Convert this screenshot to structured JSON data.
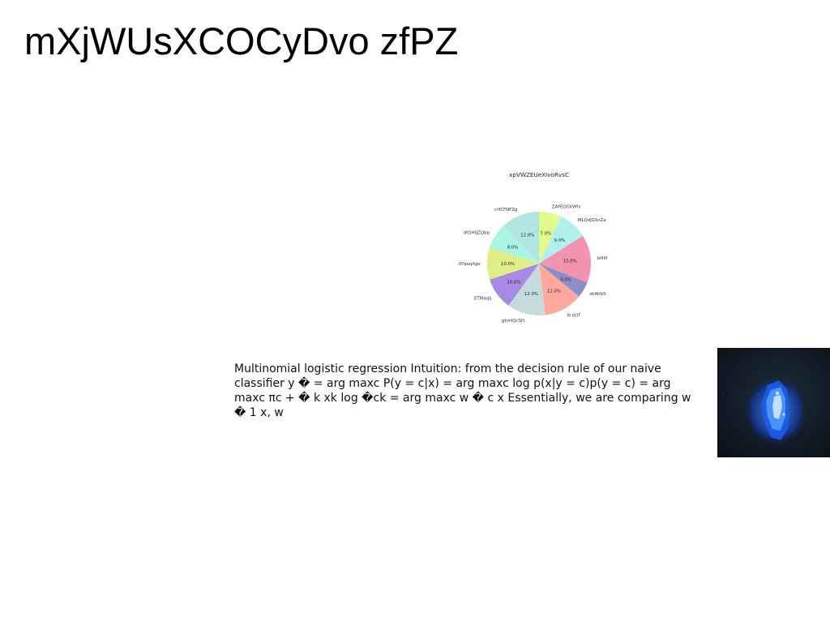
{
  "slide": {
    "title": "mXjWUsXCOCyDvo zfPZ",
    "body_text": "Multinomial logistic regression Intuition: from the decision rule of our naive classifier y � = arg maxc P(y = c|x) = arg maxc log p(x|y = c)p(y = c) = arg maxc πc + � k xk log �ck = arg maxc w � c x Essentially, we are comparing w � 1 x, w"
  },
  "chart_data": {
    "type": "pie",
    "title": "xpVWZEUeXIvoRvsC",
    "start_angle_deg": 90,
    "direction": "clockwise",
    "slices": [
      {
        "label": "ZAYEQGkWfx",
        "value": 7.0,
        "pct_label": "7.0%",
        "color": "#e2fb8c"
      },
      {
        "label": "MLQdjGSnZa",
        "value": 9.0,
        "pct_label": "9.0%",
        "color": "#b0f0ee"
      },
      {
        "label": "bHIIf",
        "value": 15.0,
        "pct_label": "15.0%",
        "color": "#f294b0"
      },
      {
        "label": "sbWrbS",
        "value": 5.0,
        "pct_label": "5.0%",
        "color": "#8c8ec8"
      },
      {
        "label": "N eOT",
        "value": 12.0,
        "pct_label": "12.0%",
        "color": "#fea89e"
      },
      {
        "label": "gkmIQcSH",
        "value": 12.0,
        "pct_label": "12.0%",
        "color": "#c6dcdc"
      },
      {
        "label": "ETMaqS",
        "value": 10.0,
        "pct_label": "10.0%",
        "color": "#a889e4"
      },
      {
        "label": "dYqaqXge",
        "value": 10.0,
        "pct_label": "10.0%",
        "color": "#e0ee88"
      },
      {
        "label": "dtGHtJZQbp",
        "value": 8.0,
        "pct_label": "8.0%",
        "color": "#aaf4e4"
      },
      {
        "label": "ctfCFNFZg",
        "value": 12.0,
        "pct_label": "12.0%",
        "color": "#b2e6e2"
      }
    ]
  },
  "image": {
    "icon": "blue-crystal-photo"
  }
}
